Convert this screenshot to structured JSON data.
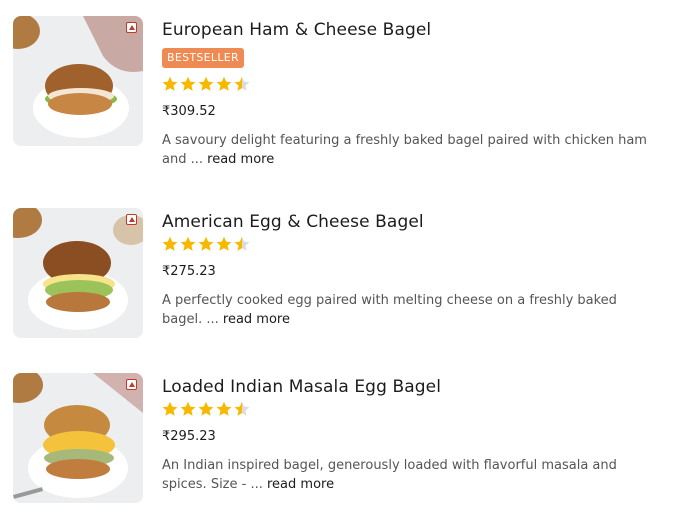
{
  "colors": {
    "badge": "#ee8a52",
    "star": "#f6b900",
    "star_empty": "#dcdcdc",
    "nonveg": "#c0392b"
  },
  "items": [
    {
      "name": "European Ham & Cheese Bagel",
      "badge": "BESTSELLER",
      "rating_stars": 4.5,
      "price": "₹309.52",
      "description": "A savoury delight featuring a freshly baked bagel paired with chicken ham and ...",
      "read_more": "read more"
    },
    {
      "name": "American Egg & Cheese Bagel",
      "badge": null,
      "rating_stars": 4.5,
      "price": "₹275.23",
      "description": "A perfectly cooked egg paired with melting cheese on a freshly baked bagel. ...",
      "read_more": "read more"
    },
    {
      "name": "Loaded Indian Masala Egg Bagel",
      "badge": null,
      "rating_stars": 4.5,
      "price": "₹295.23",
      "description": "An Indian inspired bagel, generously loaded with flavorful masala and spices. Size - ...",
      "read_more": "read more"
    }
  ]
}
